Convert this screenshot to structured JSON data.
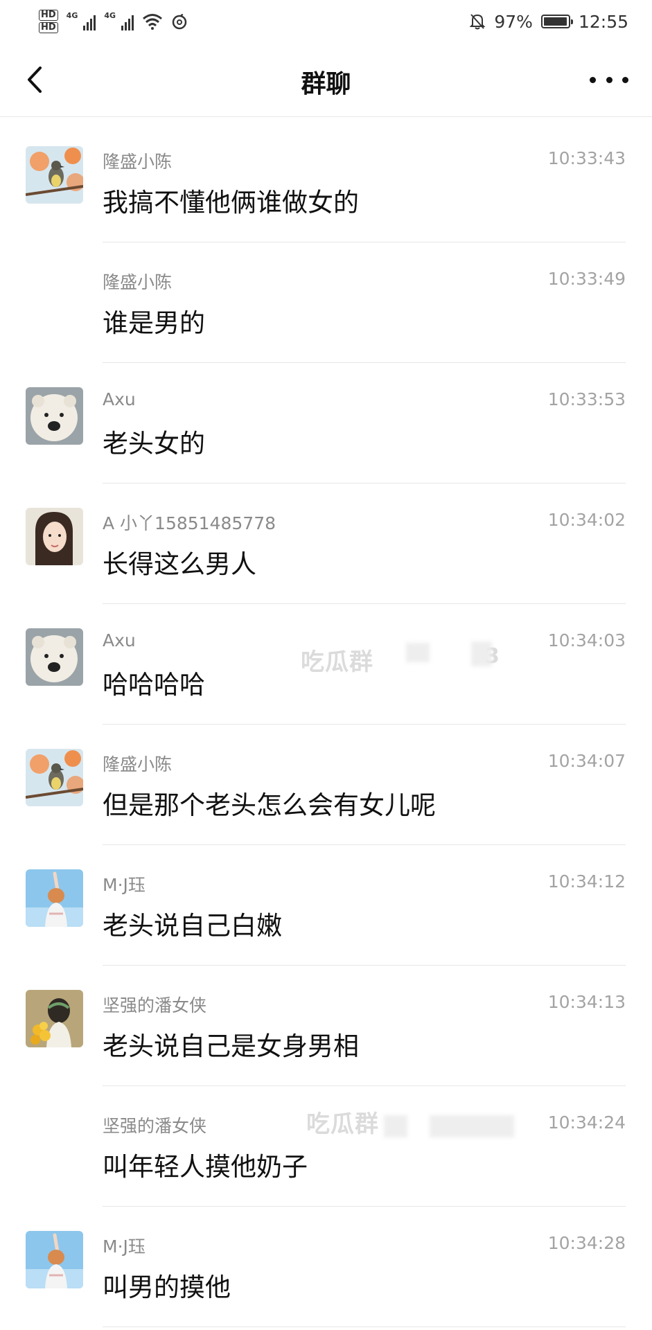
{
  "status_bar": {
    "hd1": "HD",
    "hd2": "HD",
    "net1": "4G",
    "net2": "4G",
    "battery_percent": "97%",
    "battery_level": 0.97,
    "time": "12:55"
  },
  "header": {
    "title": "群聊"
  },
  "messages": [
    {
      "sender": "隆盛小陈",
      "time": "10:33:43",
      "text": "我搞不懂他俩谁做女的",
      "avatar": "bird-avatar"
    },
    {
      "sender": "隆盛小陈",
      "time": "10:33:49",
      "text": "谁是男的",
      "avatar": ""
    },
    {
      "sender": "Axu",
      "time": "10:33:53",
      "text": "老头女的",
      "avatar": "dog-avatar"
    },
    {
      "sender": "A 小丫15851485778",
      "time": "10:34:02",
      "text": "长得这么男人",
      "avatar": "woman-avatar"
    },
    {
      "sender": "Axu",
      "time": "10:34:03",
      "text": "哈哈哈哈",
      "avatar": "dog-avatar"
    },
    {
      "sender": "隆盛小陈",
      "time": "10:34:07",
      "text": "但是那个老头怎么会有女儿呢",
      "avatar": "bird-avatar"
    },
    {
      "sender": "M·J珏",
      "time": "10:34:12",
      "text": "老头说自己白嫩",
      "avatar": "girl-sky-avatar"
    },
    {
      "sender": "坚强的潘女侠",
      "time": "10:34:13",
      "text": "老头说自己是女身男相",
      "avatar": "girl-flowers-avatar"
    },
    {
      "sender": "坚强的潘女侠",
      "time": "10:34:24",
      "text": "叫年轻人摸他奶子",
      "avatar": ""
    },
    {
      "sender": "M·J珏",
      "time": "10:34:28",
      "text": "叫男的摸他",
      "avatar": "girl-sky-avatar"
    }
  ],
  "watermarks": [
    "吃瓜群",
    "3",
    "吃瓜群"
  ],
  "colors": {
    "sender": "#8a8a8a",
    "time": "#a3a3a3",
    "message": "#111111",
    "divider": "#e6e6e6"
  }
}
